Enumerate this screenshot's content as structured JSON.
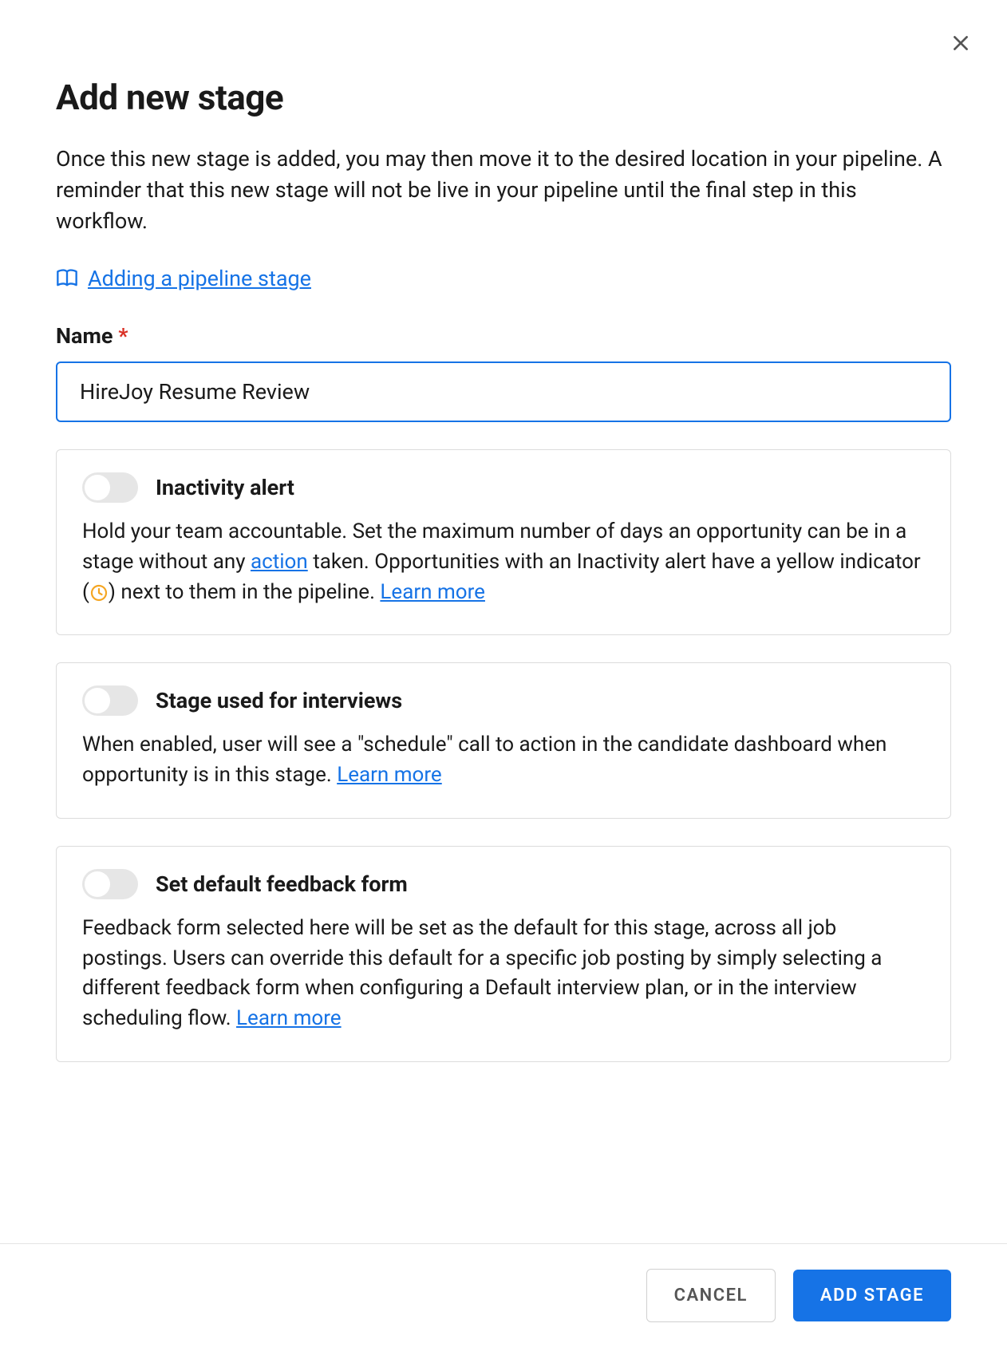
{
  "dialog": {
    "title": "Add new stage",
    "description": "Once this new stage is added, you may then move it to the desired location in your pipeline. A reminder that this new stage will not be live in your pipeline until the final step in this workflow.",
    "help_link_label": "Adding a pipeline stage"
  },
  "form": {
    "name_label": "Name",
    "required_marker": "*",
    "name_value": "HireJoy Resume Review"
  },
  "cards": {
    "inactivity": {
      "title": "Inactivity alert",
      "enabled": false,
      "desc_before_action": "Hold your team accountable. Set the maximum number of days an opportunity can be in a stage without any ",
      "action_link": "action",
      "desc_after_action": " taken. Opportunities with an Inactivity alert have a yellow indicator (",
      "desc_after_icon": ") next to them in the pipeline. ",
      "learn_more": "Learn more"
    },
    "interviews": {
      "title": "Stage used for interviews",
      "enabled": false,
      "desc": "When enabled, user will see a \"schedule\" call to action in the candidate dashboard when opportunity is in this stage. ",
      "learn_more": "Learn more"
    },
    "feedback": {
      "title": "Set default feedback form",
      "enabled": false,
      "desc": "Feedback form selected here will be set as the default for this stage, across all job postings. Users can override this default for a specific job posting by simply selecting a different feedback form when configuring a Default interview plan, or in the interview scheduling flow. ",
      "learn_more": "Learn more"
    }
  },
  "footer": {
    "cancel": "CANCEL",
    "submit": "ADD STAGE"
  }
}
